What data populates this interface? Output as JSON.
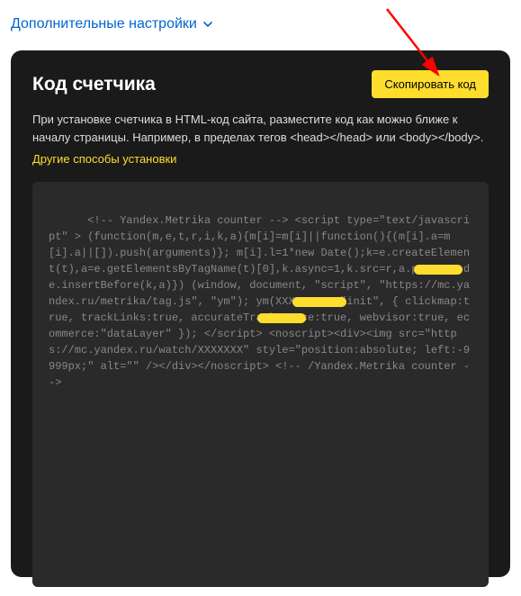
{
  "top_link": {
    "label": "Дополнительные настройки"
  },
  "panel": {
    "title": "Код счетчика",
    "copy_btn": "Скопировать код",
    "desc": "При установке счетчика в HTML-код сайта, разместите код как можно ближе к началу страницы. Например, в пределах тегов <head></head> или <body></body>.",
    "other_methods": "Другие способы установки",
    "code": "<!-- Yandex.Metrika counter --> <script type=\"text/javascript\" > (function(m,e,t,r,i,k,a){m[i]=m[i]||function(){(m[i].a=m[i].a||[]).push(arguments)}; m[i].l=1*new Date();k=e.createElement(t),a=e.getElementsByTagName(t)[0],k.async=1,k.src=r,a.parentNode.insertBefore(k,a)}) (window, document, \"script\", \"https://mc.yandex.ru/metrika/tag.js\", \"ym\"); ym(XXXXXXXX, \"init\", { clickmap:true, trackLinks:true, accurateTrackBounce:true, webvisor:true, ecommerce:\"dataLayer\" }); </script> <noscript><div><img src=\"https://mc.yandex.ru/watch/XXXXXXX\" style=\"position:absolute; left:-9999px;\" alt=\"\" /></div></noscript> <!-- /Yandex.Metrika counter -->"
  }
}
